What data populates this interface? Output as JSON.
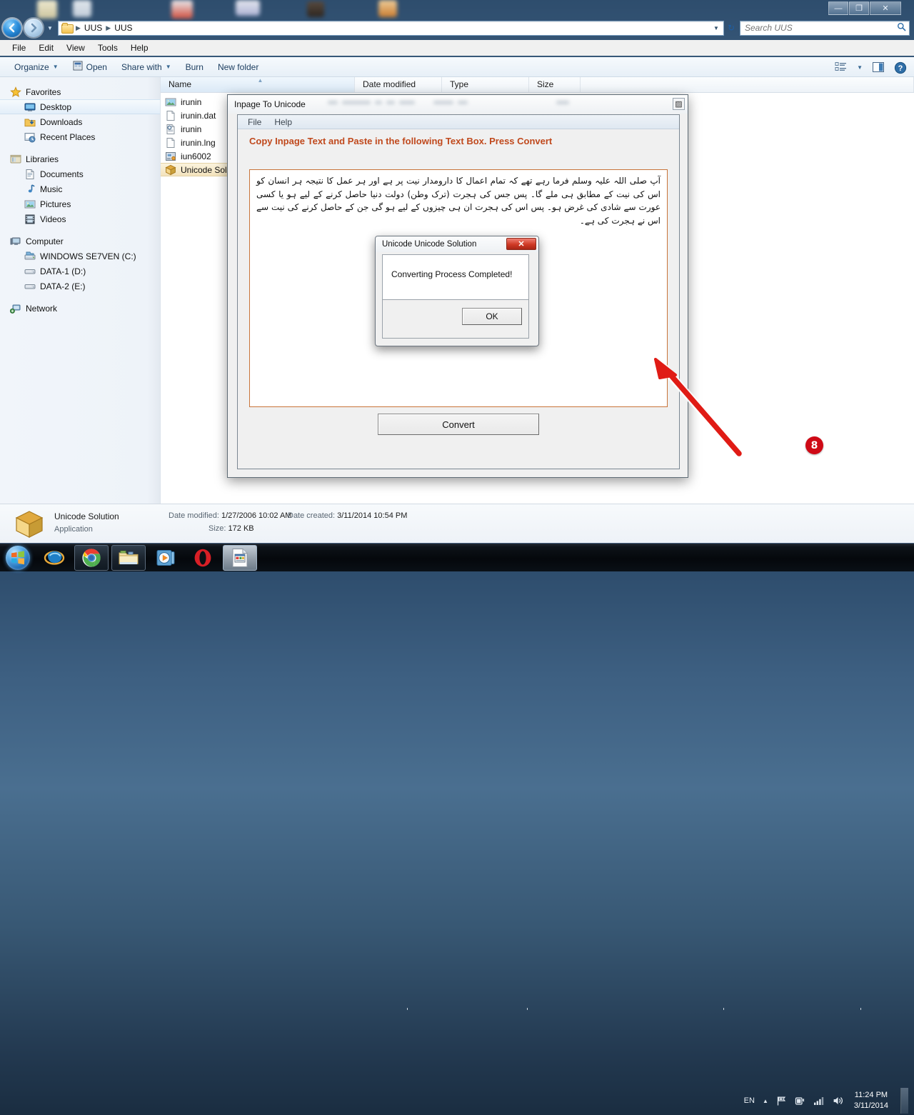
{
  "explorer": {
    "window_buttons": [
      "minimize-button",
      "maximize-button",
      "close-button"
    ],
    "minimize_glyph": "—",
    "maximize_glyph": "❐",
    "close_glyph": "✕",
    "breadcrumb": [
      "UUS",
      "UUS"
    ],
    "breadcrumb_sep": "▶",
    "addr_dropdown_glyph": "▼",
    "refresh_glyph": "↻",
    "search": {
      "placeholder": "Search UUS",
      "value": "",
      "icon": "search-icon"
    },
    "menus": [
      "File",
      "Edit",
      "View",
      "Tools",
      "Help"
    ],
    "commands": [
      {
        "label": "Organize",
        "has_chevron": true
      },
      {
        "label": "Open",
        "has_chevron": false
      },
      {
        "label": "Share with",
        "has_chevron": true
      },
      {
        "label": "Burn",
        "has_chevron": false
      },
      {
        "label": "New folder",
        "has_chevron": false
      }
    ],
    "chevron_glyph": "▼",
    "nav_groups": [
      {
        "header": {
          "label": "Favorites",
          "icon": "star-icon"
        },
        "items": [
          {
            "label": "Desktop",
            "icon": "desktop-icon",
            "selected": true
          },
          {
            "label": "Downloads",
            "icon": "downloads-folder-icon",
            "selected": false
          },
          {
            "label": "Recent Places",
            "icon": "recent-places-icon",
            "selected": false
          }
        ]
      },
      {
        "header": {
          "label": "Libraries",
          "icon": "libraries-icon"
        },
        "items": [
          {
            "label": "Documents",
            "icon": "documents-icon",
            "selected": false
          },
          {
            "label": "Music",
            "icon": "music-note-icon",
            "selected": false
          },
          {
            "label": "Pictures",
            "icon": "pictures-icon",
            "selected": false
          },
          {
            "label": "Videos",
            "icon": "videos-film-icon",
            "selected": false
          }
        ]
      },
      {
        "header": {
          "label": "Computer",
          "icon": "computer-icon"
        },
        "items": [
          {
            "label": "WINDOWS SE7VEN (C:)",
            "icon": "system-drive-icon",
            "selected": false
          },
          {
            "label": "DATA-1 (D:)",
            "icon": "drive-icon",
            "selected": false
          },
          {
            "label": "DATA-2 (E:)",
            "icon": "drive-icon",
            "selected": false
          }
        ]
      },
      {
        "header": {
          "label": "Network",
          "icon": "network-icon"
        },
        "items": []
      }
    ],
    "columns": [
      "Name",
      "Date modified",
      "Type",
      "Size"
    ],
    "sort_arrow_glyph": "▲",
    "files": [
      {
        "name": "irunin",
        "icon": "image-file-icon",
        "selected": false
      },
      {
        "name": "irunin.dat",
        "icon": "generic-file-icon",
        "selected": false
      },
      {
        "name": "irunin",
        "icon": "config-file-icon",
        "selected": false
      },
      {
        "name": "irunin.lng",
        "icon": "generic-file-icon",
        "selected": false
      },
      {
        "name": "iun6002",
        "icon": "installer-icon",
        "selected": false
      },
      {
        "name": "Unicode Sol",
        "icon": "application-box-icon",
        "selected": true
      }
    ],
    "details": {
      "name": "Unicode Solution",
      "type": "Application",
      "date_modified_label": "Date modified:",
      "date_modified_value": "1/27/2006 10:02 AM",
      "size_label": "Size:",
      "size_value": "172 KB",
      "date_created_label": "Date created:",
      "date_created_value": "3/11/2014 10:54 PM",
      "icon": "application-box-icon"
    },
    "toolbar_right_icons": [
      "view-options-icon",
      "chevron-down-icon",
      "preview-pane-icon",
      "help-icon"
    ]
  },
  "app": {
    "title": "Inpage To Unicode",
    "box_button_glyph": "▨",
    "menus": [
      "File",
      "Help"
    ],
    "heading": "Copy Inpage Text and Paste in the following Text Box. Press Convert",
    "heading_color": "#c0491d",
    "textbox_value": "آپ صلی اللہ علیہ وسلم فرما رہے تھے کہ تمام اعمال کا دارومدار نیت پر ہے اور ہر عمل کا نتیجہ ہر انسان کو اس کی نیت کے مطابق ہی ملے گا۔ پس جس کی ہجرت (ترک وطن) دولت دنیا حاصل کرنے کے لیے ہو یا کسی عورت سے شادی کی غرض ہو۔ پس اس کی ہجرت ان ہی چیزوں کے لیے ہو گی جن کے حاصل کرنے کی نیت سے اس نے ہجرت کی ہے۔",
    "convert_label": "Convert"
  },
  "modal": {
    "title": "Unicode Unicode Solution",
    "close_glyph": "✕",
    "message": "Converting Process Completed!",
    "ok_label": "OK"
  },
  "annotation": {
    "badge_number": "8",
    "arrow_color": "#e01b15",
    "badge_color": "#cf0a16"
  },
  "taskbar": {
    "start_label": "start-orb",
    "items": [
      {
        "name": "internet-explorer",
        "framed": false,
        "active": false
      },
      {
        "name": "google-chrome",
        "framed": true,
        "active": false
      },
      {
        "name": "windows-explorer",
        "framed": true,
        "active": false
      },
      {
        "name": "windows-media-player",
        "framed": false,
        "active": false
      },
      {
        "name": "opera-browser",
        "framed": false,
        "active": false
      },
      {
        "name": "inpage-unicode-app",
        "framed": false,
        "active": true
      }
    ],
    "tray": {
      "language": "EN",
      "expand_glyph": "▲",
      "icons": [
        "action-center-flag-icon",
        "power-plug-icon",
        "network-signal-icon",
        "volume-icon"
      ],
      "time": "11:24 PM",
      "date": "3/11/2014"
    }
  }
}
